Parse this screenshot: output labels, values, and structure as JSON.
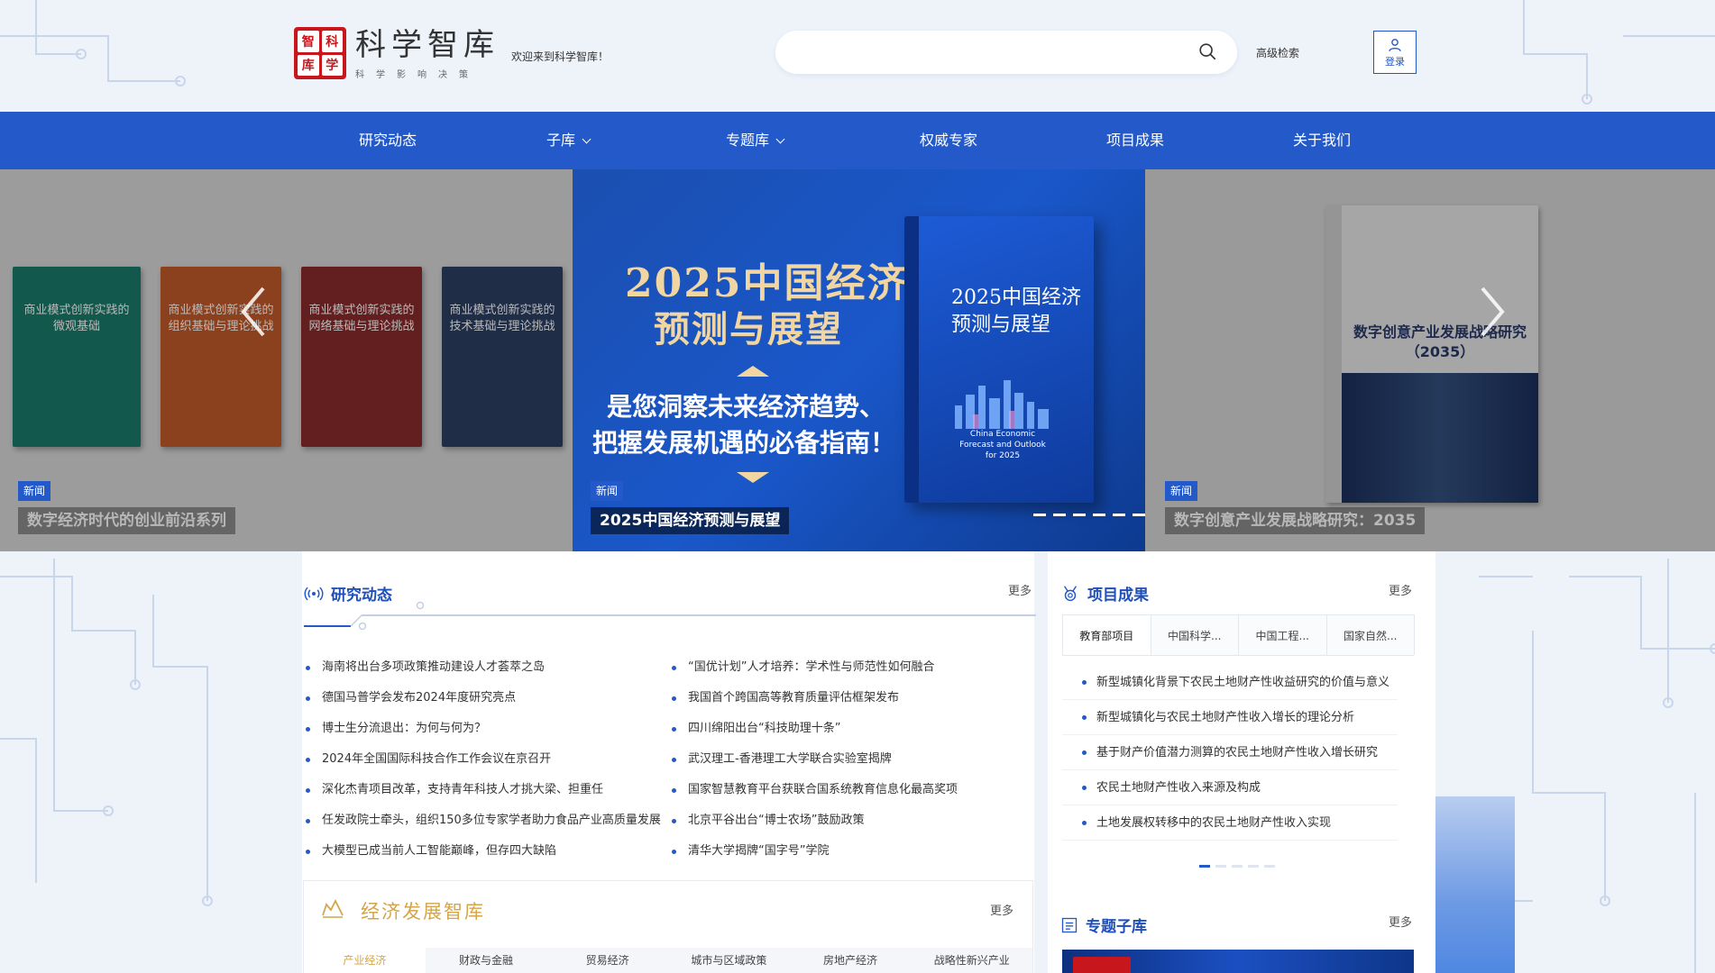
{
  "header": {
    "logo_seal": [
      "智",
      "科",
      "库",
      "学"
    ],
    "logo_title": "科学智库",
    "logo_subtitle": "科学影响决策",
    "welcome": "欢迎来到科学智库！",
    "search_placeholder": "",
    "advanced_search": "高级检索",
    "login": "登录"
  },
  "nav": [
    {
      "label": "研究动态",
      "dropdown": false
    },
    {
      "label": "子库",
      "dropdown": true
    },
    {
      "label": "专题库",
      "dropdown": true
    },
    {
      "label": "权威专家",
      "dropdown": false
    },
    {
      "label": "项目成果",
      "dropdown": false
    },
    {
      "label": "关于我们",
      "dropdown": false
    }
  ],
  "banner": {
    "slides": [
      {
        "tag": "新闻",
        "caption": "数字经济时代的创业前沿系列"
      },
      {
        "tag": "新闻",
        "caption": "2025中国经济预测与展望"
      },
      {
        "tag": "新闻",
        "caption": "数字创意产业发展战略研究：2035"
      }
    ],
    "left_books": [
      {
        "title": "商业模式创新实践的微观基础",
        "color": "#1b7a6b"
      },
      {
        "title": "商业模式创新实践的组织基础与理论挑战",
        "color": "#c25a2a"
      },
      {
        "title": "商业模式创新实践的网络基础与理论挑战",
        "color": "#8a2c2c"
      },
      {
        "title": "商业模式创新实践的技术基础与理论挑战",
        "color": "#2b3f63"
      }
    ],
    "center": {
      "year_title": "2025中国经济",
      "sub_title": "预测与展望",
      "slogan_1": "是您洞察未来经济趋势、",
      "slogan_2": "把握发展机遇的必备指南！",
      "book_title_1": "2025中国经济",
      "book_title_2": "预测与展望",
      "book_en": "China Economic Forecast and Outlook for 2025"
    },
    "right_book": {
      "title": "数字创意产业发展战略研究（2035）"
    },
    "dots": 6
  },
  "research": {
    "title": "研究动态",
    "more": "更多",
    "left": [
      "海南将出台多项政策推动建设人才荟萃之岛",
      "德国马普学会发布2024年度研究亮点",
      "博士生分流退出：为何与何为？",
      "2024年全国国际科技合作工作会议在京召开",
      "深化杰青项目改革，支持青年科技人才挑大梁、担重任",
      "任发政院士牵头，组织150多位专家学者助力食品产业高质量发展",
      "大模型已成当前人工智能巅峰，但存四大缺陷"
    ],
    "right": [
      "“国优计划”人才培养：学术性与师范性如何融合",
      "我国首个跨国高等教育质量评估框架发布",
      "四川绵阳出台“科技助理十条”",
      "武汉理工-香港理工大学联合实验室揭牌",
      "国家智慧教育平台获联合国系统教育信息化最高奖项",
      "北京平谷出台“博士农场”鼓励政策",
      "清华大学揭牌“国字号”学院"
    ]
  },
  "projects": {
    "title": "项目成果",
    "more": "更多",
    "tabs": [
      "教育部项目",
      "中国科学...",
      "中国工程...",
      "国家自然..."
    ],
    "items": [
      "新型城镇化背景下农民土地财产性收益研究的价值与意义",
      "新型城镇化与农民土地财产性收入增长的理论分析",
      "基于财产价值潜力测算的农民土地财产性收入增长研究",
      "农民土地财产性收入来源及构成",
      "土地发展权转移中的农民土地财产性收入实现"
    ],
    "dots": 5
  },
  "econ": {
    "title": "经济发展智库",
    "more": "更多",
    "tabs": [
      "产业经济",
      "财政与金融",
      "贸易经济",
      "城市与区域政策",
      "房地产经济",
      "战略性新兴产业"
    ]
  },
  "topics": {
    "title": "专题子库",
    "more": "更多"
  },
  "colors": {
    "primary": "#2359c8",
    "gold": "#d4a54a",
    "seal": "#c8161d"
  }
}
